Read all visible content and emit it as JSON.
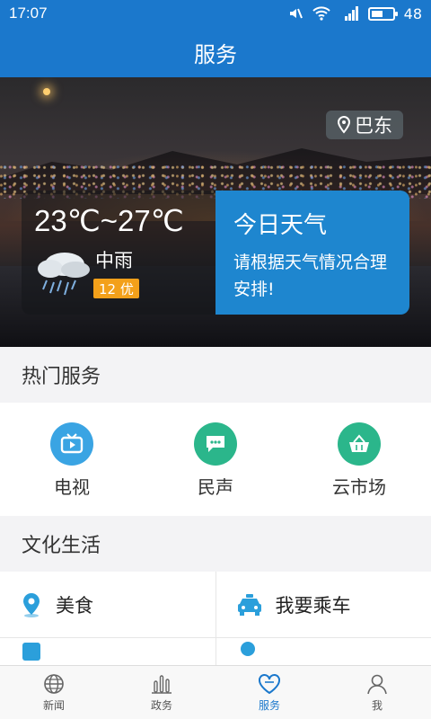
{
  "status_bar": {
    "time": "17:07",
    "battery": "48",
    "battery_level": 0.48,
    "signal_label": "3G"
  },
  "header": {
    "title": "服务"
  },
  "banner": {
    "location": "巴东",
    "weather": {
      "temperature": "23℃~27℃",
      "condition": "中雨",
      "aqi": "12 优",
      "today_title": "今日天气",
      "advice": "请根据天气情况合理安排!"
    }
  },
  "hot_services": {
    "title": "热门服务",
    "items": [
      {
        "label": "电视",
        "icon": "tv-icon",
        "color": "#3aa4e3"
      },
      {
        "label": "民声",
        "icon": "chat-icon",
        "color": "#2bb68b"
      },
      {
        "label": "云市场",
        "icon": "basket-icon",
        "color": "#2bb68b"
      }
    ]
  },
  "culture": {
    "title": "文化生活",
    "items": [
      {
        "label": "美食",
        "icon": "location-pin-icon",
        "color": "#2b9fdb"
      },
      {
        "label": "我要乘车",
        "icon": "taxi-icon",
        "color": "#2b9fdb"
      }
    ]
  },
  "bottom_nav": {
    "items": [
      {
        "label": "新闻",
        "icon": "globe-icon"
      },
      {
        "label": "政务",
        "icon": "bar-chart-icon"
      },
      {
        "label": "服务",
        "icon": "heart-icon",
        "active": true
      },
      {
        "label": "我",
        "icon": "person-icon"
      }
    ]
  }
}
